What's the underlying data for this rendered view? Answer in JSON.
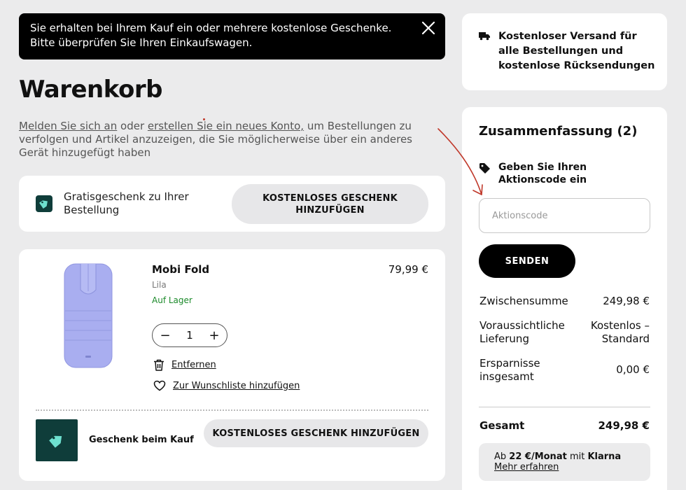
{
  "toast": {
    "message": "Sie erhalten bei Ihrem Kauf ein oder mehrere kostenlose Geschenke. Bitte überprüfen Sie Ihren Einkaufswagen."
  },
  "page": {
    "title": "Warenkorb"
  },
  "signin": {
    "login_link": "Melden Sie sich an",
    "or": " oder ",
    "register_link": "erstellen Sie ein neues Konto,",
    "rest": " um Bestellungen zu verfolgen und Artikel anzuzeigen, die Sie möglicherweise über ein anderes Gerät hinzugefügt haben"
  },
  "gift_bar": {
    "text": "Gratisgeschenk zu Ihrer Bestellung",
    "button": "KOSTENLOSES GESCHENK HINZUFÜGEN"
  },
  "product": {
    "name": "Mobi Fold",
    "variant": "Lila",
    "stock": "Auf Lager",
    "price": "79,99 €",
    "quantity": "1",
    "decrement": "−",
    "increment": "+",
    "remove": "Entfernen",
    "wishlist": "Zur Wunschliste hinzufügen",
    "image_color": "#a9aef0"
  },
  "purchase_gift": {
    "text": "Geschenk beim Kauf",
    "button": "KOSTENLOSES GESCHENK HINZUFÜGEN"
  },
  "shipping": {
    "text": "Kostenloser Versand für alle Bestellungen und kostenlose Rücksendungen"
  },
  "summary": {
    "title": "Zusammenfassung (2)",
    "promo_label": "Geben Sie Ihren Aktionscode ein",
    "promo_placeholder": "Aktionscode",
    "send": "SENDEN",
    "subtotal_label": "Zwischensumme",
    "subtotal_value": "249,98 €",
    "delivery_label": "Voraussichtliche Lieferung",
    "delivery_value": "Kostenlos – Standard",
    "savings_label": "Ersparnisse insgesamt",
    "savings_value": "0,00 €",
    "total_label": "Gesamt",
    "total_value": "249,98 €",
    "klarna_prefix": "Ab ",
    "klarna_amount": "22 €/Monat",
    "klarna_mid": " mit ",
    "klarna_brand": "Klarna",
    "klarna_more": "Mehr erfahren"
  },
  "colors": {
    "accent_dark": "#0f3d3a",
    "accent_mint": "#6ee0cf",
    "stock_green": "#1b8a2a",
    "annotation_red": "#c0392b"
  }
}
